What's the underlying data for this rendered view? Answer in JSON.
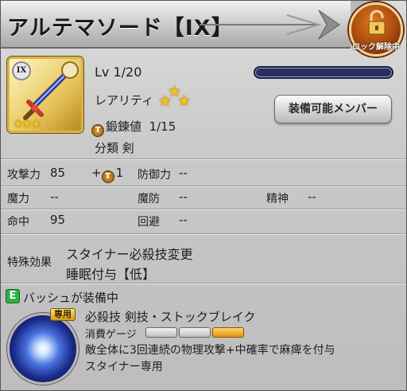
{
  "title": "アルテマソード【IX】",
  "lock_badge": {
    "label": "ロック解除中",
    "icon": "padlock-open-icon"
  },
  "thumbnail": {
    "rank": "IX",
    "stars": "★★★",
    "icon": "sword-icon",
    "type_icon": "sword-type-icon"
  },
  "level": {
    "label": "Lv 1/20",
    "progress": 0.0
  },
  "rarity": {
    "label": "レアリティ",
    "stars": 3
  },
  "equip_button": {
    "label": "装備可能メンバー"
  },
  "forge": {
    "label": "鍛錬値",
    "value": "1/15",
    "icon": "forge-icon"
  },
  "category": {
    "label": "分類",
    "value": "剣"
  },
  "stats": {
    "atk_label": "攻撃力",
    "atk_value": "85",
    "atk_bonus": "1",
    "def_label": "防御力",
    "def_value": "--",
    "mag_label": "魔力",
    "mag_value": "--",
    "mdef_label": "魔防",
    "mdef_value": "--",
    "spr_label": "精神",
    "spr_value": "--",
    "acc_label": "命中",
    "acc_value": "95",
    "eva_label": "回避",
    "eva_value": "--"
  },
  "special": {
    "label": "特殊効果",
    "effects": [
      "スタイナー必殺技変更",
      "睡眠付与【低】"
    ]
  },
  "equipped_by": {
    "badge": "E",
    "label": "バッシュが装備中"
  },
  "skill": {
    "tag": "専用",
    "name": "必殺技 剣技・ストックブレイク",
    "gauge_label": "消費ゲージ",
    "gauge_filled": 1,
    "gauge_total": 3,
    "description": "敵全体に3回連続の物理攻撃+中確率で麻痺を付与",
    "note": "スタイナー専用"
  },
  "colors": {
    "gold": "#f4c21c",
    "lock_orange": "#c15a12",
    "equip_green": "#2fb042",
    "gauge_on": "#e0940e"
  }
}
